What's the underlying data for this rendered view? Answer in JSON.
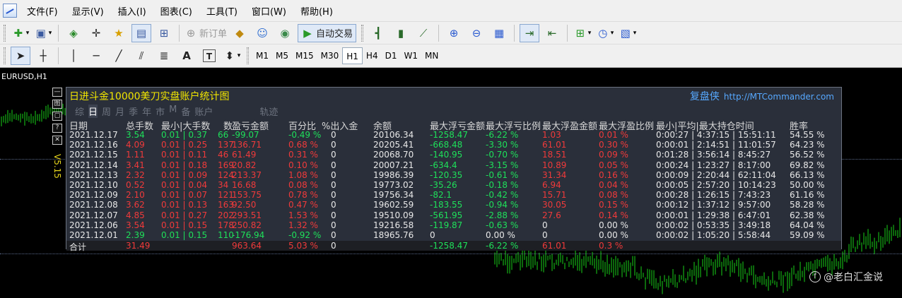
{
  "menu": {
    "items": [
      "文件(F)",
      "显示(V)",
      "插入(I)",
      "图表(C)",
      "工具(T)",
      "窗口(W)",
      "帮助(H)"
    ]
  },
  "toolbar": {
    "new_order": "新订单",
    "auto_trade": "自动交易",
    "timeframes": [
      "M1",
      "M5",
      "M15",
      "M30",
      "H1",
      "H4",
      "D1",
      "W1",
      "MN"
    ],
    "active_timeframe": "H1",
    "text_tool": "A",
    "label_tool": "T"
  },
  "chart": {
    "symbol_title": "EURUSD,H1",
    "version": "V5.15"
  },
  "panel": {
    "title": "日进斗金10000美刀实盘账户统计图",
    "brand": "复盘侠",
    "brand_url": "http://MTCommander.com",
    "side_buttons": [
      "—",
      "图",
      "▢",
      "?",
      "✕"
    ],
    "tabs": [
      "综",
      "日",
      "周",
      "月",
      "季",
      "年",
      "市",
      "M",
      "备",
      "账户",
      "轨迹"
    ],
    "active_tab": "日",
    "headers": [
      "日期",
      "总手数",
      "最小|大手数",
      "数",
      "盈亏金额",
      "百分比",
      "%出入金",
      "余额",
      "最大浮亏金额",
      "最大浮亏比例",
      "最大浮盈金额",
      "最大浮盈比例",
      "最小|平均|最大持仓时间",
      "胜率"
    ],
    "rows": [
      {
        "date": "2021.12.17",
        "lots": "3.54",
        "minmax": "0.01 | 0.37",
        "count": "66",
        "pnl": "-99.07",
        "pct": "-0.49 %",
        "inout": "0",
        "balance": "20106.34",
        "max_float_loss": "-1258.47",
        "max_float_loss_pct": "-6.22 %",
        "max_float_profit": "1.03",
        "max_float_profit_pct": "0.01 %",
        "hold_time": "0:00:27 | 4:37:15 | 15:51:11",
        "winrate": "54.55 %",
        "lots_color": "g",
        "pnl_color": "g",
        "pct_color": "g"
      },
      {
        "date": "2021.12.16",
        "lots": "4.09",
        "minmax": "0.01 | 0.25",
        "count": "137",
        "pnl": "136.71",
        "pct": "0.68 %",
        "inout": "0",
        "balance": "20205.41",
        "max_float_loss": "-668.48",
        "max_float_loss_pct": "-3.30 %",
        "max_float_profit": "61.01",
        "max_float_profit_pct": "0.30 %",
        "hold_time": "0:00:01 | 2:14:51 | 11:01:57",
        "winrate": "64.23 %",
        "lots_color": "r",
        "pnl_color": "r",
        "pct_color": "r"
      },
      {
        "date": "2021.12.15",
        "lots": "1.11",
        "minmax": "0.01 | 0.11",
        "count": "46",
        "pnl": "61.49",
        "pct": "0.31 %",
        "inout": "0",
        "balance": "20068.70",
        "max_float_loss": "-140.95",
        "max_float_loss_pct": "-0.70 %",
        "max_float_profit": "18.51",
        "max_float_profit_pct": "0.09 %",
        "hold_time": "0:01:28 | 3:56:14 | 8:45:27",
        "winrate": "56.52 %",
        "lots_color": "r",
        "pnl_color": "r",
        "pct_color": "r"
      },
      {
        "date": "2021.12.14",
        "lots": "3.41",
        "minmax": "0.01 | 0.18",
        "count": "169",
        "pnl": "20.82",
        "pct": "0.10 %",
        "inout": "0",
        "balance": "20007.21",
        "max_float_loss": "-634.4",
        "max_float_loss_pct": "-3.15 %",
        "max_float_profit": "10.89",
        "max_float_profit_pct": "0.05 %",
        "hold_time": "0:00:24 | 1:23:27 | 8:17:00",
        "winrate": "69.82 %",
        "lots_color": "r",
        "pnl_color": "r",
        "pct_color": "r"
      },
      {
        "date": "2021.12.13",
        "lots": "2.32",
        "minmax": "0.01 | 0.09",
        "count": "124",
        "pnl": "213.37",
        "pct": "1.08 %",
        "inout": "0",
        "balance": "19986.39",
        "max_float_loss": "-120.35",
        "max_float_loss_pct": "-0.61 %",
        "max_float_profit": "31.34",
        "max_float_profit_pct": "0.16 %",
        "hold_time": "0:00:09 | 2:20:44 | 62:11:04",
        "winrate": "66.13 %",
        "lots_color": "r",
        "pnl_color": "r",
        "pct_color": "r"
      },
      {
        "date": "2021.12.10",
        "lots": "0.52",
        "minmax": "0.01 | 0.04",
        "count": "34",
        "pnl": "16.68",
        "pct": "0.08 %",
        "inout": "0",
        "balance": "19773.02",
        "max_float_loss": "-35.26",
        "max_float_loss_pct": "-0.18 %",
        "max_float_profit": "6.94",
        "max_float_profit_pct": "0.04 %",
        "hold_time": "0:00:05 | 2:57:20 | 10:14:23",
        "winrate": "50.00 %",
        "lots_color": "r",
        "pnl_color": "r",
        "pct_color": "r"
      },
      {
        "date": "2021.12.09",
        "lots": "2.10",
        "minmax": "0.01 | 0.07",
        "count": "121",
        "pnl": "153.75",
        "pct": "0.78 %",
        "inout": "0",
        "balance": "19756.34",
        "max_float_loss": "-82.1",
        "max_float_loss_pct": "-0.42 %",
        "max_float_profit": "15.71",
        "max_float_profit_pct": "0.08 %",
        "hold_time": "0:00:28 | 1:26:15 | 7:43:23",
        "winrate": "61.16 %",
        "lots_color": "r",
        "pnl_color": "r",
        "pct_color": "r"
      },
      {
        "date": "2021.12.08",
        "lots": "3.62",
        "minmax": "0.01 | 0.13",
        "count": "163",
        "pnl": "92.50",
        "pct": "0.47 %",
        "inout": "0",
        "balance": "19602.59",
        "max_float_loss": "-183.55",
        "max_float_loss_pct": "-0.94 %",
        "max_float_profit": "30.05",
        "max_float_profit_pct": "0.15 %",
        "hold_time": "0:00:12 | 1:37:12 | 9:57:00",
        "winrate": "58.28 %",
        "lots_color": "r",
        "pnl_color": "r",
        "pct_color": "r"
      },
      {
        "date": "2021.12.07",
        "lots": "4.85",
        "minmax": "0.01 | 0.27",
        "count": "202",
        "pnl": "293.51",
        "pct": "1.53 %",
        "inout": "0",
        "balance": "19510.09",
        "max_float_loss": "-561.95",
        "max_float_loss_pct": "-2.88 %",
        "max_float_profit": "27.6",
        "max_float_profit_pct": "0.14 %",
        "hold_time": "0:00:01 | 1:29:38 | 6:47:01",
        "winrate": "62.38 %",
        "lots_color": "r",
        "pnl_color": "r",
        "pct_color": "r"
      },
      {
        "date": "2021.12.06",
        "lots": "3.54",
        "minmax": "0.01 | 0.15",
        "count": "178",
        "pnl": "250.82",
        "pct": "1.32 %",
        "inout": "0",
        "balance": "19216.58",
        "max_float_loss": "-119.87",
        "max_float_loss_pct": "-0.63 %",
        "max_float_profit": "0",
        "max_float_profit_pct": "0.00 %",
        "hold_time": "0:00:02 | 0:53:35 | 3:49:18",
        "winrate": "64.04 %",
        "lots_color": "r",
        "pnl_color": "r",
        "pct_color": "r"
      },
      {
        "date": "2021.12.01",
        "lots": "2.39",
        "minmax": "0.01 | 0.15",
        "count": "110",
        "pnl": "-176.94",
        "pct": "-0.92 %",
        "inout": "0",
        "balance": "18965.76",
        "max_float_loss": "0",
        "max_float_loss_pct": "0.00 %",
        "max_float_profit": "0",
        "max_float_profit_pct": "0.00 %",
        "hold_time": "0:00:02 | 1:05:20 | 5:58:44",
        "winrate": "59.09 %",
        "lots_color": "g",
        "pnl_color": "g",
        "pct_color": "g"
      }
    ],
    "summary": {
      "label": "合计",
      "lots": "31.49",
      "pnl": "963.64",
      "pct": "5.03 %",
      "inout": "0",
      "max_float_loss": "-1258.47",
      "max_float_loss_pct": "-6.22 %",
      "max_float_profit": "61.01",
      "max_float_profit_pct": "0.3 %"
    }
  },
  "watermark": "@老白汇金说",
  "colors": {
    "profit": "#f03a3a",
    "loss": "#1ee05a",
    "title": "#f2e600",
    "brand": "#56a8ff"
  }
}
